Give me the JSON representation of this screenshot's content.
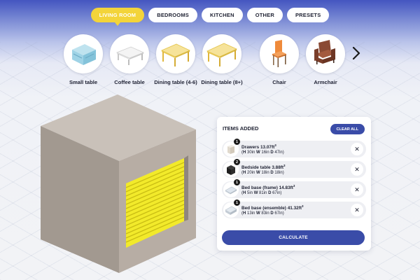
{
  "tabs": [
    {
      "label": "LIVING ROOM",
      "active": true
    },
    {
      "label": "BEDROOMS",
      "active": false
    },
    {
      "label": "KITCHEN",
      "active": false
    },
    {
      "label": "OTHER",
      "active": false
    },
    {
      "label": "PRESETS",
      "active": false
    }
  ],
  "furniture": [
    {
      "label": "Small table",
      "icon": "small-table-icon"
    },
    {
      "label": "Coffee table",
      "icon": "coffee-table-icon"
    },
    {
      "label": "Dining table (4-6)",
      "icon": "dining-table-4-6-icon"
    },
    {
      "label": "Dining table (8+)",
      "icon": "dining-table-8-icon"
    },
    {
      "label": "Chair",
      "icon": "chair-icon"
    },
    {
      "label": "Armchair",
      "icon": "armchair-icon"
    }
  ],
  "colors": {
    "accent_yellow": "#f3d43a",
    "primary_blue": "#3a4ca8",
    "unit_front": "#b7ada4",
    "unit_side": "#a29990",
    "unit_top": "#c9c1b9",
    "door": "#f2ea2a"
  },
  "panel": {
    "title": "ITEMS ADDED",
    "clear_label": "CLEAR ALL",
    "calculate_label": "CALCULATE",
    "items": [
      {
        "name": "Drawers 13.07ft",
        "qty": "1",
        "h": "30in",
        "w": "16in",
        "d": "47in"
      },
      {
        "name": "Bedside table 3.88ft",
        "qty": "2",
        "h": "20in",
        "w": "18in",
        "d": "18in"
      },
      {
        "name": "Bed base (frame) 14.83ft",
        "qty": "1",
        "h": "5in",
        "w": "81in",
        "d": "67in"
      },
      {
        "name": "Bed base (ensemble) 41.32ft",
        "qty": "1",
        "h": "13in",
        "w": "83in",
        "d": "67in"
      }
    ]
  }
}
